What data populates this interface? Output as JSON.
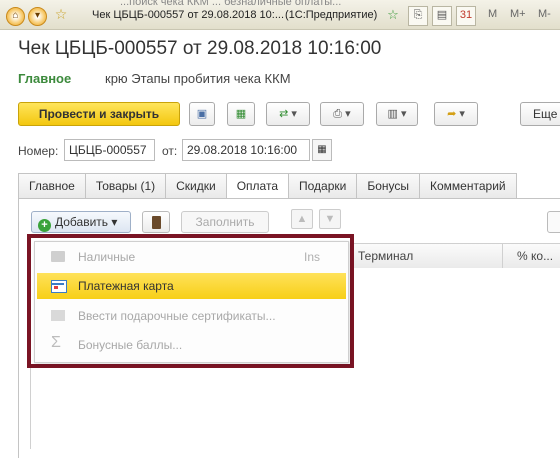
{
  "titlebar": {
    "background_text": "...поиск чека ККМ ... безналичные оплаты...",
    "window_title": "Чек ЦБЦБ-000557 от 29.08.2018 10:...",
    "app_name": "(1С:Предприятие)",
    "m_label": "M",
    "mplus_label": "M+",
    "mminus_label": "M-"
  },
  "header": {
    "title": "Чек ЦБЦБ-000557 от 29.08.2018 10:16:00",
    "nav_main": "Главное",
    "nav_link": "крю Этапы пробития чека ККМ"
  },
  "toolbar": {
    "post_close_label": "Провести и закрыть",
    "more_label": "Еще"
  },
  "fields": {
    "number_label": "Номер:",
    "number_value": "ЦБЦБ-000557",
    "date_label": "от:",
    "date_value": "29.08.2018 10:16:00"
  },
  "tabs": [
    {
      "label": "Главное",
      "active": false
    },
    {
      "label": "Товары (1)",
      "active": false
    },
    {
      "label": "Скидки",
      "active": false
    },
    {
      "label": "Оплата",
      "active": true
    },
    {
      "label": "Подарки",
      "active": false
    },
    {
      "label": "Бонусы",
      "active": false
    },
    {
      "label": "Комментарий",
      "active": false
    }
  ],
  "payment": {
    "add_label": "Добавить",
    "fill_label": "Заполнить",
    "columns": [
      "Терминал",
      "% ко..."
    ]
  },
  "dropdown": {
    "items": [
      {
        "label": "Наличные",
        "shortcut": "Ins",
        "enabled": false,
        "highlighted": false,
        "icon": "cash-icon"
      },
      {
        "label": "Платежная карта",
        "shortcut": "",
        "enabled": true,
        "highlighted": true,
        "icon": "card-icon"
      },
      {
        "label": "Ввести подарочные сертификаты...",
        "shortcut": "",
        "enabled": false,
        "highlighted": false,
        "icon": "gift-certificate-icon"
      },
      {
        "label": "Бонусные баллы...",
        "shortcut": "",
        "enabled": false,
        "highlighted": false,
        "icon": "sigma-icon"
      }
    ],
    "highlight_color": "#F7CF17",
    "frame_color": "#7A1424"
  }
}
